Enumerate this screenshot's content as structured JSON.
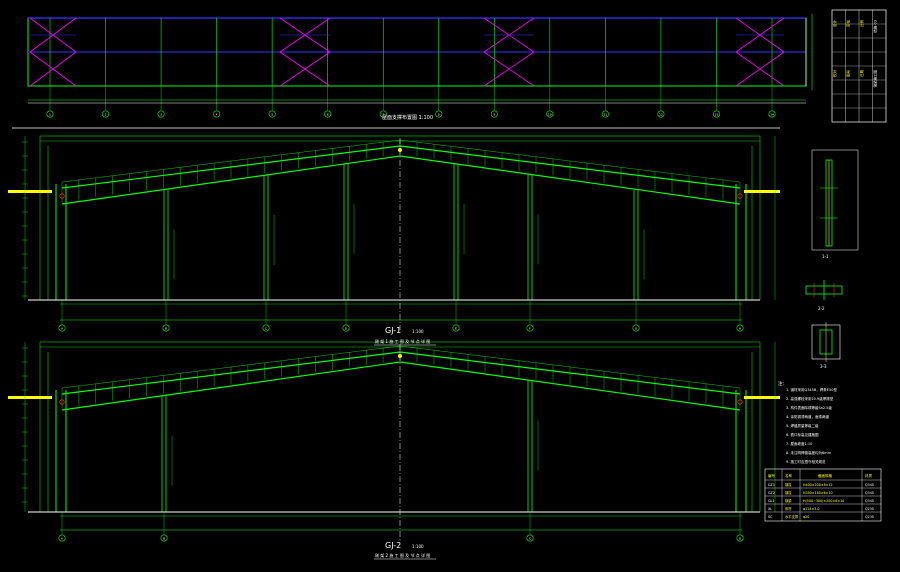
{
  "drawing": {
    "background": "#000000",
    "colors": {
      "frame": "#00ff00",
      "bracing": "#ff00ff",
      "purlin_line": "#3333ff",
      "text": "#ffffff",
      "marker": "#ffff00",
      "dim": "#00ffff",
      "red": "#ff2020"
    }
  },
  "titles": {
    "frame1_name": "GJ-1",
    "frame1_scale": "1:100",
    "frame1_caption": "刚 架 1 施 工 图 及 节 点 详 图",
    "frame2_name": "GJ-2",
    "frame2_scale": "1:100",
    "frame2_caption": "刚 架 2 施 工 图 及 节 点 详 图",
    "plan_caption": "屋面支撑布置图 1:100",
    "detail_a": "1-1",
    "detail_b": "2-2",
    "detail_c": "3-3"
  },
  "axes": {
    "plan_grid": [
      "1",
      "2",
      "3",
      "4",
      "5",
      "6",
      "7",
      "8",
      "9",
      "10",
      "11",
      "12",
      "13",
      "14"
    ],
    "frame1_grid": [
      "A",
      "B",
      "C",
      "D",
      "E",
      "F",
      "G",
      "H"
    ],
    "frame2_grid": [
      "A",
      "B",
      "C",
      "D"
    ]
  },
  "notes": {
    "heading": "注：",
    "lines": [
      "1. 钢材采用Q345B，焊条E50型",
      "2. 高强螺栓采用10.9级摩擦型",
      "3. 构件表面除锈等级Sa2.5级",
      "4. 涂防锈漆两道，面漆两道",
      "5. 焊缝质量等级二级",
      "6. 檐口标高见建施图",
      "7. 屋面坡度1:10",
      "8. 未注明焊缝高度均为6mm",
      "9. 施工时应遵守相关规范"
    ]
  },
  "member_table": {
    "headers": [
      "编号",
      "名称",
      "截面规格",
      "材质"
    ],
    "rows": [
      [
        "GZ1",
        "钢柱",
        "H400×200×8×12",
        "Q345"
      ],
      [
        "GZ2",
        "钢柱",
        "H350×180×6×10",
        "Q345"
      ],
      [
        "GL1",
        "钢梁",
        "H(500~300)×200×6×10",
        "Q345"
      ],
      [
        "XL",
        "系杆",
        "φ114×3.0",
        "Q235"
      ],
      [
        "SC",
        "水平支撑",
        "φ20",
        "Q235"
      ]
    ]
  },
  "title_block": {
    "cells": [
      "设计",
      "校对",
      "审核",
      "图号",
      "比例",
      "日期",
      "结施-03",
      "钢架施工图"
    ]
  }
}
